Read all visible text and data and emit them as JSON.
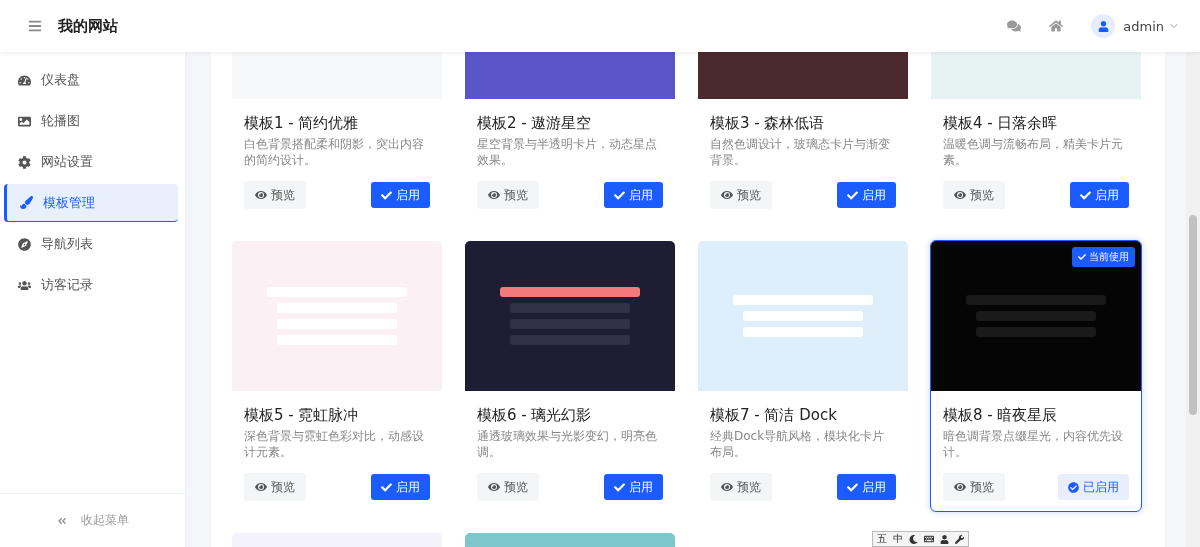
{
  "header": {
    "site_title": "我的网站",
    "user": "admin"
  },
  "sidebar": {
    "items": [
      {
        "label": "仪表盘",
        "selected": false
      },
      {
        "label": "轮播图",
        "selected": false
      },
      {
        "label": "网站设置",
        "selected": false
      },
      {
        "label": "模板管理",
        "selected": true
      },
      {
        "label": "导航列表",
        "selected": false
      },
      {
        "label": "访客记录",
        "selected": false
      }
    ],
    "collapse_label": "收起菜单"
  },
  "templates": [
    {
      "kind": "light",
      "title": "模板1 - 简约优雅",
      "description": "白色背景搭配柔和阴影，突出内容的简约设计。",
      "preview_label": "预览",
      "enable_label": "启用",
      "active": false
    },
    {
      "kind": "purple",
      "title": "模板2 - 遨游星空",
      "description": "星空背景与半透明卡片，动态星点效果。",
      "preview_label": "预览",
      "enable_label": "启用",
      "active": false
    },
    {
      "kind": "wine",
      "title": "模板3 - 森林低语",
      "description": "自然色调设计，玻璃态卡片与渐变背景。",
      "preview_label": "预览",
      "enable_label": "启用",
      "active": false
    },
    {
      "kind": "mint",
      "title": "模板4 - 日落余晖",
      "description": "温暖色调与流畅布局，精美卡片元素。",
      "preview_label": "预览",
      "enable_label": "启用",
      "active": false
    },
    {
      "kind": "pink",
      "title": "模板5 - 霓虹脉冲",
      "description": "深色背景与霓虹色彩对比，动感设计元素。",
      "preview_label": "预览",
      "enable_label": "启用",
      "active": false
    },
    {
      "kind": "navy",
      "title": "模板6 - 璃光幻影",
      "description": "通透玻璃效果与光影变幻，明亮色调。",
      "preview_label": "预览",
      "enable_label": "启用",
      "active": false
    },
    {
      "kind": "sky",
      "title": "模板7 - 简洁 Dock",
      "description": "经典Dock导航风格，模块化卡片布局。",
      "preview_label": "预览",
      "enable_label": "启用",
      "active": false
    },
    {
      "kind": "black",
      "title": "模板8 - 暗夜星辰",
      "description": "暗色调背景点缀星光，内容优先设计。",
      "preview_label": "预览",
      "enable_label": "已启用",
      "active": true,
      "badge": "当前使用"
    },
    {
      "kind": "lavender"
    },
    {
      "kind": "teal"
    }
  ],
  "ime_toolbar": {
    "items": [
      "五",
      "中"
    ]
  }
}
